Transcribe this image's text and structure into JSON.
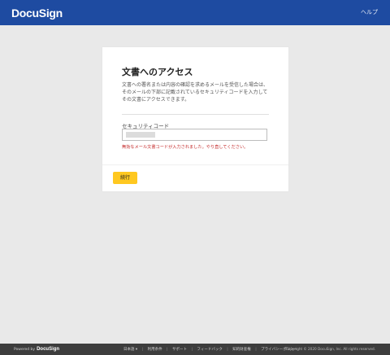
{
  "header": {
    "logo": "DocuSign",
    "help_label": "ヘルプ"
  },
  "card": {
    "title": "文書へのアクセス",
    "description": "文書への署名または内容の確認を求めるメールを受信した場合は、そのメールの下部に記載されているセキュリティコードを入力してその文書にアクセスできます。",
    "code_label": "セキュリティコード",
    "code_value": "",
    "error_message": "無効なメール文書コードが入力されました。やり直してください。",
    "continue_label": "続行"
  },
  "footer": {
    "powered_by": "Powered by",
    "powered_logo": "DocuSign",
    "language": "日本語 ▾",
    "links": [
      "利用条件",
      "サポート",
      "フィードバック",
      "知的財産権",
      "プライバシーポリシー"
    ],
    "separator": "|",
    "copyright": "Copyright © 2020 DocuSign, Inc. All rights reserved."
  },
  "colors": {
    "header_bg": "#1e4ba1",
    "accent_button": "#ffc820",
    "error_text": "#c42a2a",
    "footer_bg": "#3d3d3d"
  }
}
